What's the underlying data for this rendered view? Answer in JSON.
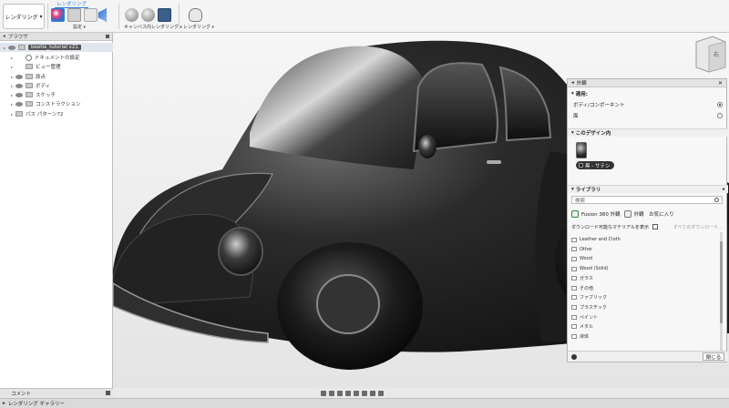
{
  "toolbar": {
    "workspace_label": "レンダリング",
    "section_label": "レンダリング",
    "groups": [
      {
        "label": "設定"
      },
      {
        "label": "キャンバス内レンダリング"
      },
      {
        "label": "レンダリング"
      }
    ]
  },
  "browser": {
    "title": "ブラウザ",
    "root": "beetle_tutorial v21",
    "items": [
      {
        "label": "ドキュメントの設定"
      },
      {
        "label": "ビュー管理"
      },
      {
        "label": "原点"
      },
      {
        "label": "ボディ"
      },
      {
        "label": "スケッチ"
      },
      {
        "label": "コンストラクション"
      },
      {
        "label": "パス パターン72"
      }
    ]
  },
  "viewcube": {
    "face_label": "右"
  },
  "appearance": {
    "title": "外観",
    "apply_section": "適用:",
    "apply_options": [
      {
        "label": "ボディ/コンポーネント",
        "selected": true
      },
      {
        "label": "面",
        "selected": false
      }
    ],
    "design_section": "このデザイン内",
    "material_name": "黒 - サテン",
    "library_section": "ライブラリ",
    "search_placeholder": "検索",
    "tab_fusion": "Fusion 360 外観",
    "tab_favorites": "外観　お気に入り",
    "download_label": "ダウンロード可能なマテリアルを表示",
    "download_all": "すべてのダウンロード...",
    "library_items": [
      "Leather and Cloth",
      "Other",
      "Wood",
      "Wood (Solid)",
      "ガラス",
      "その他",
      "ファブリック",
      "プラスチック",
      "ペイント",
      "メタル",
      "液体"
    ],
    "close_label": "閉じる"
  },
  "comments_label": "コメント",
  "gallery_label": "レンダリング ギャラリー",
  "colors": {
    "accent": "#2a7fd4",
    "car_body": "#1e1e1e"
  }
}
